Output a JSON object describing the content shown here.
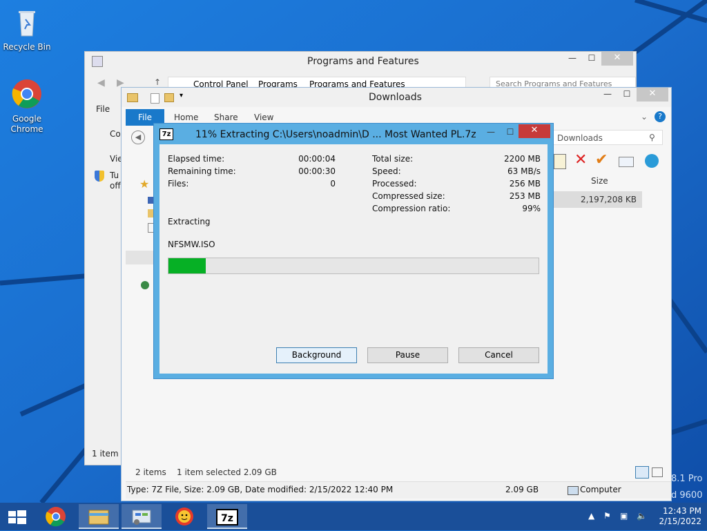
{
  "desktop": {
    "icons": [
      {
        "label": "Recycle Bin"
      },
      {
        "label": "Google\nChrome"
      }
    ],
    "watermark": [
      "8.1 Pro",
      "d 9600"
    ]
  },
  "programs_features": {
    "title": "Programs and Features",
    "breadcrumb": [
      "Control Panel",
      "Programs",
      "Programs and Features"
    ],
    "search_placeholder": "Search Programs and Features",
    "menu_file": "File",
    "left_text": [
      "Co",
      "Vie",
      "Tu",
      "off"
    ],
    "status": "1 item s"
  },
  "downloads": {
    "title": "Downloads",
    "tabs": [
      "File",
      "Home",
      "Share",
      "View"
    ],
    "search_text": "Downloads",
    "col_size": "Size",
    "size_value": "2,197,208 KB",
    "status_items": "2 items",
    "status_selected": "1 item selected  2.09 GB",
    "details_text": "Type: 7Z File, Size: 2.09 GB, Date modified: 2/15/2022 12:40 PM",
    "details_size": "2.09 GB",
    "details_location": "Computer"
  },
  "sevenzip": {
    "title": "11% Extracting C:\\Users\\noadmin\\D ...  Most Wanted PL.7z",
    "app_icon": "7z",
    "progress_fraction": 0.1,
    "left_stats": [
      {
        "label": "Elapsed time:",
        "value": "00:00:04"
      },
      {
        "label": "Remaining time:",
        "value": "00:00:30"
      },
      {
        "label": "Files:",
        "value": "0"
      }
    ],
    "right_stats": [
      {
        "label": "Total size:",
        "value": "2200 MB"
      },
      {
        "label": "Speed:",
        "value": "63 MB/s"
      },
      {
        "label": "Processed:",
        "value": "256 MB"
      },
      {
        "label": "Compressed size:",
        "value": "253 MB"
      },
      {
        "label": "Compression ratio:",
        "value": "99%"
      }
    ],
    "action": "Extracting",
    "current_file": "NFSMW.ISO",
    "buttons": {
      "background": "Background",
      "pause": "Pause",
      "cancel": "Cancel"
    }
  },
  "taskbar": {
    "time": "12:43 PM",
    "date": "2/15/2022",
    "apps": [
      "start-icon",
      "chrome-icon",
      "file-explorer-icon",
      "control-panel-icon",
      "sun-app-icon",
      "7zip-icon"
    ]
  }
}
